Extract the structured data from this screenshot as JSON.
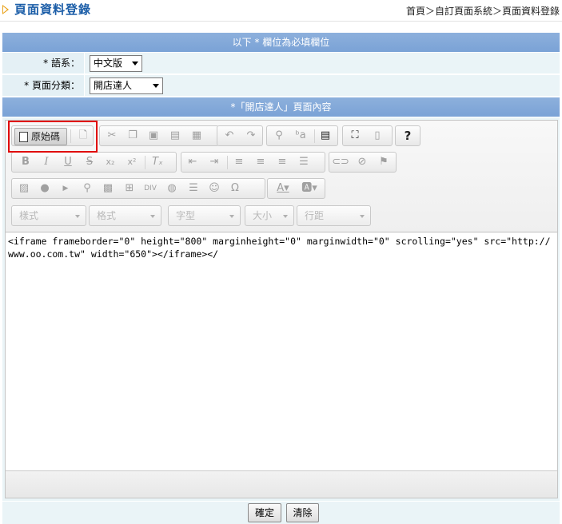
{
  "header": {
    "title": "頁面資料登錄",
    "breadcrumb": "首頁＞自訂頁面系統＞頁面資料登錄"
  },
  "form": {
    "required_note": "以下 * 欄位為必填欄位",
    "language_label": "* 語系：",
    "language_value": "中文版",
    "category_label": "* 頁面分類：",
    "category_value": "開店達人",
    "content_header": "*「開店達人」頁面內容"
  },
  "editor": {
    "source_label": "原始碼",
    "style_combo": "樣式",
    "format_combo": "格式",
    "font_combo": "字型",
    "size_combo": "大小",
    "line_height_combo": "行距",
    "content": "<iframe frameborder=\"0\" height=\"800\" marginheight=\"0\" marginwidth=\"0\" scrolling=\"yes\" src=\"http://www.oo.com.tw\" width=\"650\"></iframe></"
  },
  "actions": {
    "confirm": "確定",
    "clear": "清除"
  }
}
